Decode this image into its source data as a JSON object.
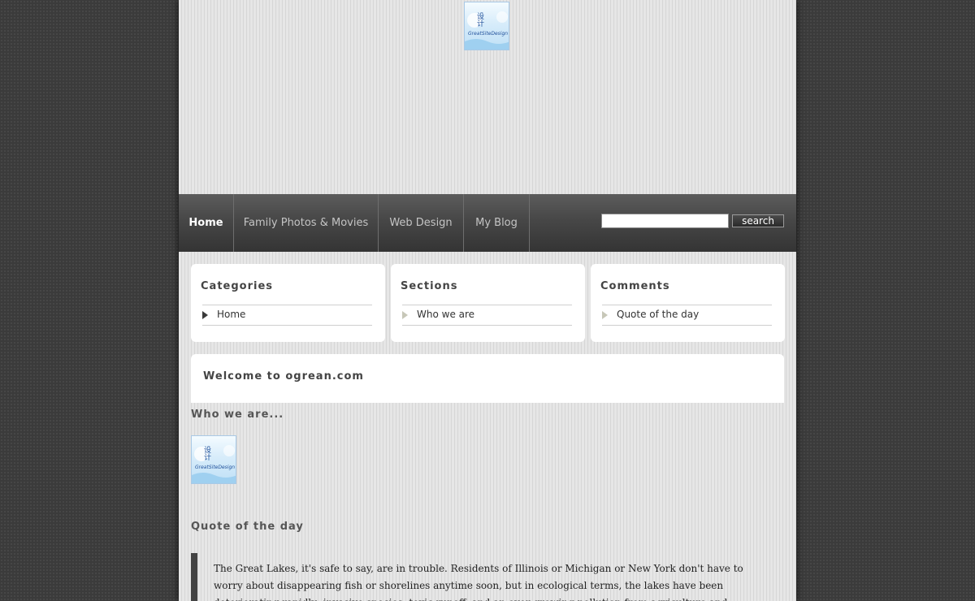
{
  "header": {
    "logo_icon": "greatsitedesign-logo-icon",
    "logo_text": "GreatSiteDesign"
  },
  "nav": {
    "items": [
      {
        "label": "Home",
        "active": true
      },
      {
        "label": "Family Photos & Movies",
        "active": false
      },
      {
        "label": "Web Design",
        "active": false
      },
      {
        "label": "My Blog",
        "active": false
      }
    ],
    "search": {
      "value": "",
      "placeholder": "",
      "button_label": "search"
    }
  },
  "boxes": [
    {
      "title": "Categories",
      "link": "Home"
    },
    {
      "title": "Sections",
      "link": "Who we are"
    },
    {
      "title": "Comments",
      "link": "Quote of the day"
    }
  ],
  "main": {
    "welcome_title": "Welcome to ogrean.com",
    "who_heading": "Who we are...",
    "quote_heading": "Quote of the day",
    "quote_text": "The Great Lakes, it's safe to say, are in trouble. Residents of Illinois or Michigan or New York don't have to worry about disappearing fish or shorelines anytime soon, but in ecological terms, the lakes have been deteriorating rapidly: invasive species, toxic runoff, and an ever-growing pollution from agriculture and industry have all been taking a toll on..."
  },
  "colors": {
    "page_bg": "#3b3b3b",
    "content_bg": "#e2e2e2",
    "nav_bg": "#474747",
    "accent": "#444444"
  }
}
